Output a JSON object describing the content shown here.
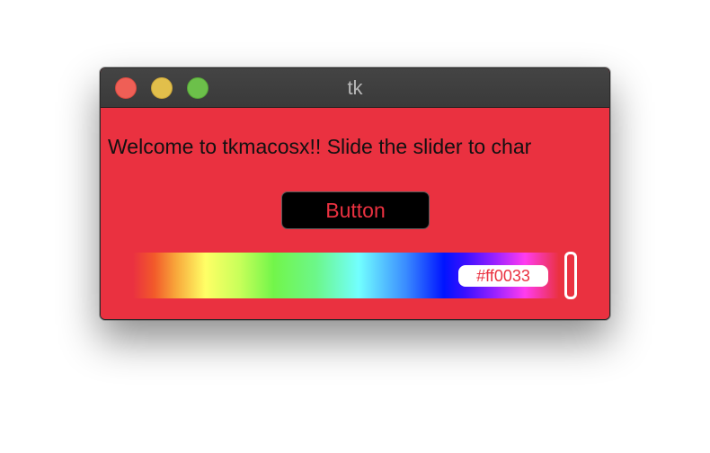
{
  "window": {
    "title": "tk"
  },
  "content": {
    "welcome_text": "Welcome to tkmacosx!! Slide the slider to char",
    "button_label": "Button",
    "color_value": "#ff0033"
  },
  "colors": {
    "background": "#ea3140",
    "button_bg": "#000000",
    "button_text": "#ea3140"
  }
}
